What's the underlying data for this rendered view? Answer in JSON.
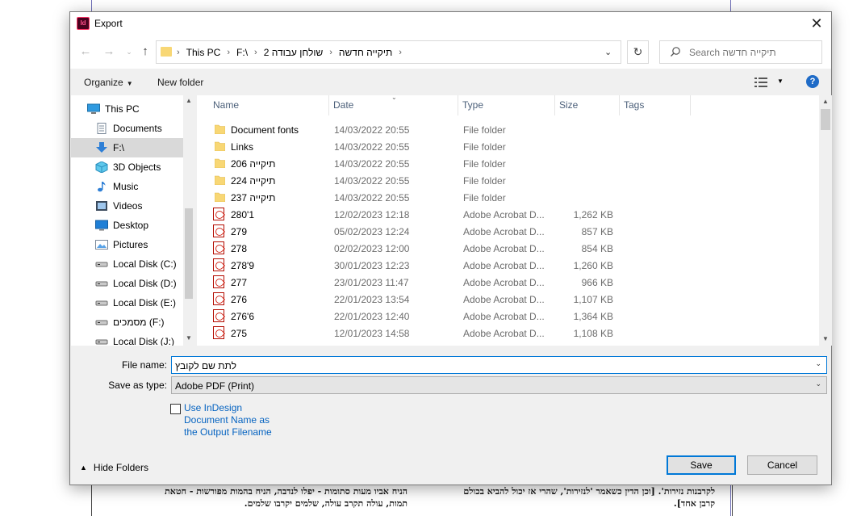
{
  "background_document": {
    "line1": "לקרבנות נזירות'. [וכן הדין כשאמר 'לנזירות', שהרי אז יכול להביא בכולם",
    "line2": "קרבן אחד].",
    "line3": "הניח אביו מעות סתומות - יפלו לנדבה, הניח בהמות מפורשות - חטאת",
    "line4": "תמות, עולה תקרב עולה, שלמים יקרבו שלמים."
  },
  "dialog": {
    "title": "Export",
    "app_icon_label": "Id"
  },
  "address_bar": {
    "crumbs": [
      "This PC",
      "F:\\",
      "שולחן עבודה 2",
      "תיקייה חדשה"
    ]
  },
  "search": {
    "placeholder": "Search תיקייה חדשה"
  },
  "toolbar": {
    "organize": "Organize",
    "new_folder": "New folder",
    "help": "?"
  },
  "nav_pane": {
    "items": [
      {
        "label": "This PC",
        "icon": "pc-icon"
      },
      {
        "label": "Documents",
        "icon": "documents-icon"
      },
      {
        "label": "F:\\",
        "icon": "download-arrow-icon",
        "selected": true
      },
      {
        "label": "3D Objects",
        "icon": "cube-icon"
      },
      {
        "label": "Music",
        "icon": "music-icon"
      },
      {
        "label": "Videos",
        "icon": "videos-icon"
      },
      {
        "label": "Desktop",
        "icon": "desktop-icon"
      },
      {
        "label": "Pictures",
        "icon": "pictures-icon"
      },
      {
        "label": "Local Disk (C:)",
        "icon": "drive-icon"
      },
      {
        "label": "Local Disk (D:)",
        "icon": "drive-icon"
      },
      {
        "label": "Local Disk (E:)",
        "icon": "drive-icon"
      },
      {
        "label": "מסמכים (F:)",
        "icon": "drive-icon"
      },
      {
        "label": "Local Disk (J:)",
        "icon": "drive-icon"
      }
    ]
  },
  "file_list": {
    "columns": {
      "name": "Name",
      "date": "Date",
      "type": "Type",
      "size": "Size",
      "tags": "Tags"
    },
    "rows": [
      {
        "name": "Document fonts",
        "date": "14/03/2022 20:55",
        "type": "File folder",
        "size": "",
        "kind": "folder"
      },
      {
        "name": "Links",
        "date": "14/03/2022 20:55",
        "type": "File folder",
        "size": "",
        "kind": "folder"
      },
      {
        "name": "206 תיקייה",
        "date": "14/03/2022 20:55",
        "type": "File folder",
        "size": "",
        "kind": "folder"
      },
      {
        "name": "224 תיקייה",
        "date": "14/03/2022 20:55",
        "type": "File folder",
        "size": "",
        "kind": "folder"
      },
      {
        "name": "237 תיקייה",
        "date": "14/03/2022 20:55",
        "type": "File folder",
        "size": "",
        "kind": "folder"
      },
      {
        "name": "280'1",
        "date": "12/02/2023 12:18",
        "type": "Adobe Acrobat D...",
        "size": "1,262 KB",
        "kind": "pdf"
      },
      {
        "name": "279",
        "date": "05/02/2023 12:24",
        "type": "Adobe Acrobat D...",
        "size": "857 KB",
        "kind": "pdf"
      },
      {
        "name": "278",
        "date": "02/02/2023 12:00",
        "type": "Adobe Acrobat D...",
        "size": "854 KB",
        "kind": "pdf"
      },
      {
        "name": "278'9",
        "date": "30/01/2023 12:23",
        "type": "Adobe Acrobat D...",
        "size": "1,260 KB",
        "kind": "pdf"
      },
      {
        "name": "277",
        "date": "23/01/2023 11:47",
        "type": "Adobe Acrobat D...",
        "size": "966 KB",
        "kind": "pdf"
      },
      {
        "name": "276",
        "date": "22/01/2023 13:54",
        "type": "Adobe Acrobat D...",
        "size": "1,107 KB",
        "kind": "pdf"
      },
      {
        "name": "276'6",
        "date": "22/01/2023 12:40",
        "type": "Adobe Acrobat D...",
        "size": "1,364 KB",
        "kind": "pdf"
      },
      {
        "name": "275",
        "date": "12/01/2023 14:58",
        "type": "Adobe Acrobat D...",
        "size": "1,108 KB",
        "kind": "pdf"
      }
    ]
  },
  "form": {
    "file_name_label": "File name:",
    "file_name_value": "לתת שם לקובץ",
    "save_type_label": "Save as type:",
    "save_type_value": "Adobe PDF (Print)",
    "use_indesign_name": "Use InDesign Document Name as the Output Filename",
    "use_indesign_checked": false
  },
  "footer": {
    "hide_folders": "Hide Folders",
    "save": "Save",
    "cancel": "Cancel"
  },
  "colors": {
    "accent": "#0078d7",
    "folder": "#f8d775",
    "pdf": "#d32c1f",
    "link": "#0563c1"
  }
}
